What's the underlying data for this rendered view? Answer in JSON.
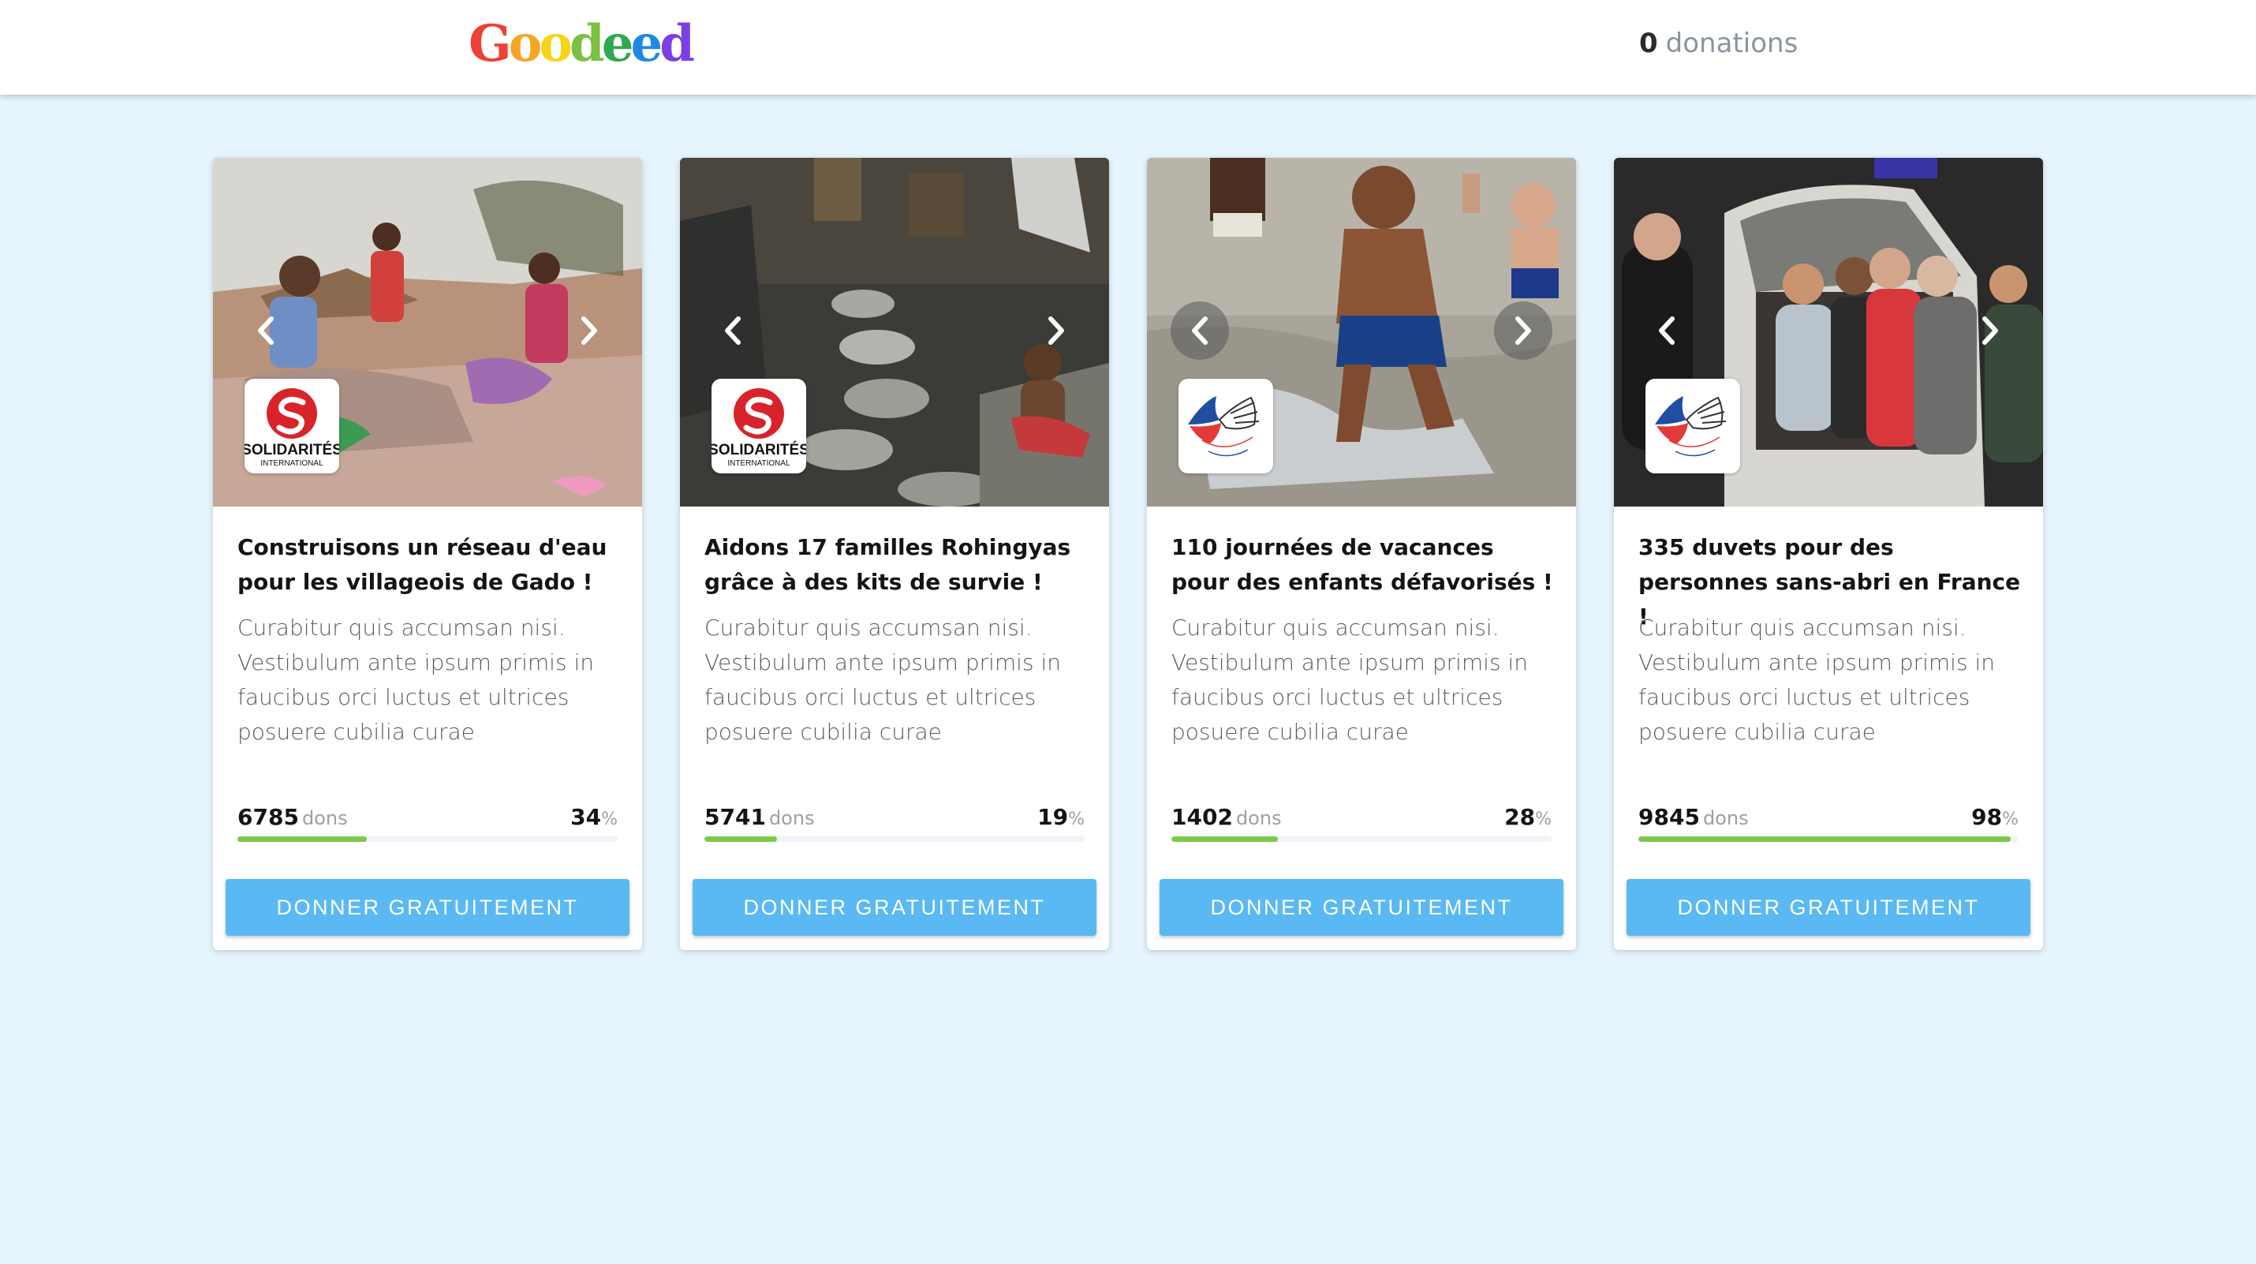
{
  "header": {
    "logo_text": "Goodeed",
    "donations_count": "0",
    "donations_label": "donations"
  },
  "cards": [
    {
      "title": "Construisons un réseau d'eau pour les villageois de Gado !",
      "description": "Curabitur quis accumsan nisi. Vestibulum ante ipsum primis in faucibus orci luctus et ultrices posuere cubilia curae",
      "count": "6785",
      "count_label": "dons",
      "percent": "34",
      "percent_sign": "%",
      "progress": 0.34,
      "button_label": "DONNER GRATUITEMENT",
      "org_name": "SOLIDARITÉS",
      "org_sub": "INTERNATIONAL",
      "photo_icon": "village-children-photo"
    },
    {
      "title": "Aidons 17 familles Rohingyas grâce à des kits de survie !",
      "description": "Curabitur quis accumsan nisi. Vestibulum ante ipsum primis in faucibus orci luctus et ultrices posuere cubilia curae",
      "count": "5741",
      "count_label": "dons",
      "percent": "19",
      "percent_sign": "%",
      "progress": 0.19,
      "button_label": "DONNER GRATUITEMENT",
      "org_name": "SOLIDARITÉS",
      "org_sub": "INTERNATIONAL",
      "photo_icon": "camp-path-photo"
    },
    {
      "title": "110 journées de vacances pour des enfants défavorisés !",
      "description": "Curabitur quis accumsan nisi. Vestibulum ante ipsum primis in faucibus orci luctus et ultrices posuere cubilia curae",
      "count": "1402",
      "count_label": "dons",
      "percent": "28",
      "percent_sign": "%",
      "progress": 0.28,
      "button_label": "DONNER GRATUITEMENT",
      "photo_icon": "beach-kids-photo"
    },
    {
      "title": "335 duvets pour des personnes sans-abri en France !",
      "description": "Curabitur quis accumsan nisi. Vestibulum ante ipsum primis in faucibus orci luctus et ultrices posuere cubilia curae",
      "count": "9845",
      "count_label": "dons",
      "percent": "98",
      "percent_sign": "%",
      "progress": 0.98,
      "button_label": "DONNER GRATUITEMENT",
      "photo_icon": "night-van-photo"
    }
  ],
  "colors": {
    "page_bg": "#e5f4fd",
    "button": "#5ab9f2",
    "progress": "#7cc94a"
  }
}
